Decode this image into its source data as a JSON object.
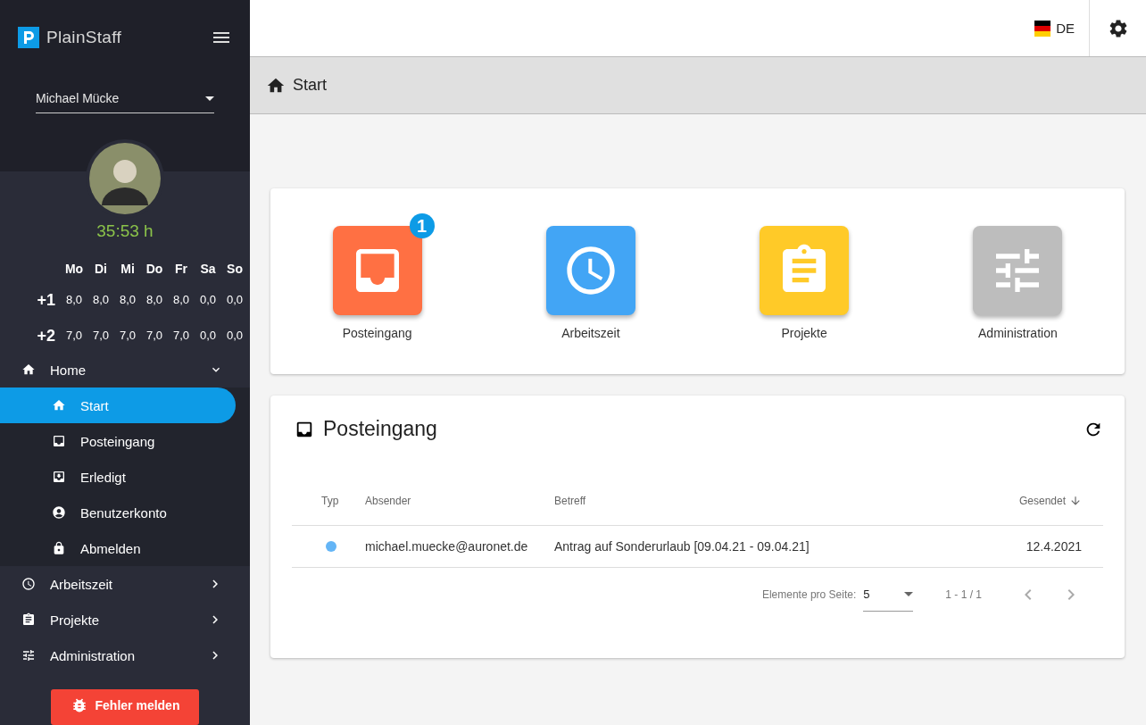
{
  "app": {
    "title": "PlainStaff"
  },
  "user": {
    "name": "Michael Mücke"
  },
  "hours": "35:53 h",
  "week": {
    "days": [
      "Mo",
      "Di",
      "Mi",
      "Do",
      "Fr",
      "Sa",
      "So"
    ],
    "rows": [
      {
        "label": "+1",
        "values": [
          "8,0",
          "8,0",
          "8,0",
          "8,0",
          "8,0",
          "0,0",
          "0,0"
        ]
      },
      {
        "label": "+2",
        "values": [
          "7,0",
          "7,0",
          "7,0",
          "7,0",
          "7,0",
          "0,0",
          "0,0"
        ]
      }
    ]
  },
  "nav": [
    {
      "label": "Home",
      "kind": "home",
      "expanded": true,
      "selected": false,
      "children": [
        {
          "label": "Start",
          "kind": "home",
          "selected": true
        },
        {
          "label": "Posteingang",
          "kind": "inbox",
          "selected": false
        },
        {
          "label": "Erledigt",
          "kind": "done",
          "selected": false
        },
        {
          "label": "Benutzerkonto",
          "kind": "account",
          "selected": false
        },
        {
          "label": "Abmelden",
          "kind": "lock",
          "selected": false
        }
      ]
    },
    {
      "label": "Arbeitszeit",
      "kind": "clock",
      "expanded": false,
      "selected": false
    },
    {
      "label": "Projekte",
      "kind": "clipboard",
      "expanded": false,
      "selected": false
    },
    {
      "label": "Administration",
      "kind": "tune",
      "expanded": false,
      "selected": false
    }
  ],
  "report_button": "Fehler melden",
  "topbar": {
    "language": "DE"
  },
  "breadcrumb": "Start",
  "tiles": [
    {
      "label": "Posteingang",
      "kind": "inbox",
      "color": "#ff7043",
      "badge": "1"
    },
    {
      "label": "Arbeitszeit",
      "kind": "clock",
      "color": "#42a5f5"
    },
    {
      "label": "Projekte",
      "kind": "clipboard",
      "color": "#ffca28"
    },
    {
      "label": "Administration",
      "kind": "tune",
      "color": "#bdbdbd"
    }
  ],
  "inbox": {
    "title": "Posteingang",
    "columns": [
      "Typ",
      "Absender",
      "Betreff",
      "Gesendet"
    ],
    "rows": [
      {
        "color": "#64b5f6",
        "sender": "michael.muecke@auronet.de",
        "subject": "Antrag auf Sonderurlaub [09.04.21 - 09.04.21]",
        "sent": "12.4.2021"
      }
    ],
    "paginator": {
      "label": "Elemente pro Seite:",
      "page_size": "5",
      "range": "1 - 1 / 1"
    }
  }
}
